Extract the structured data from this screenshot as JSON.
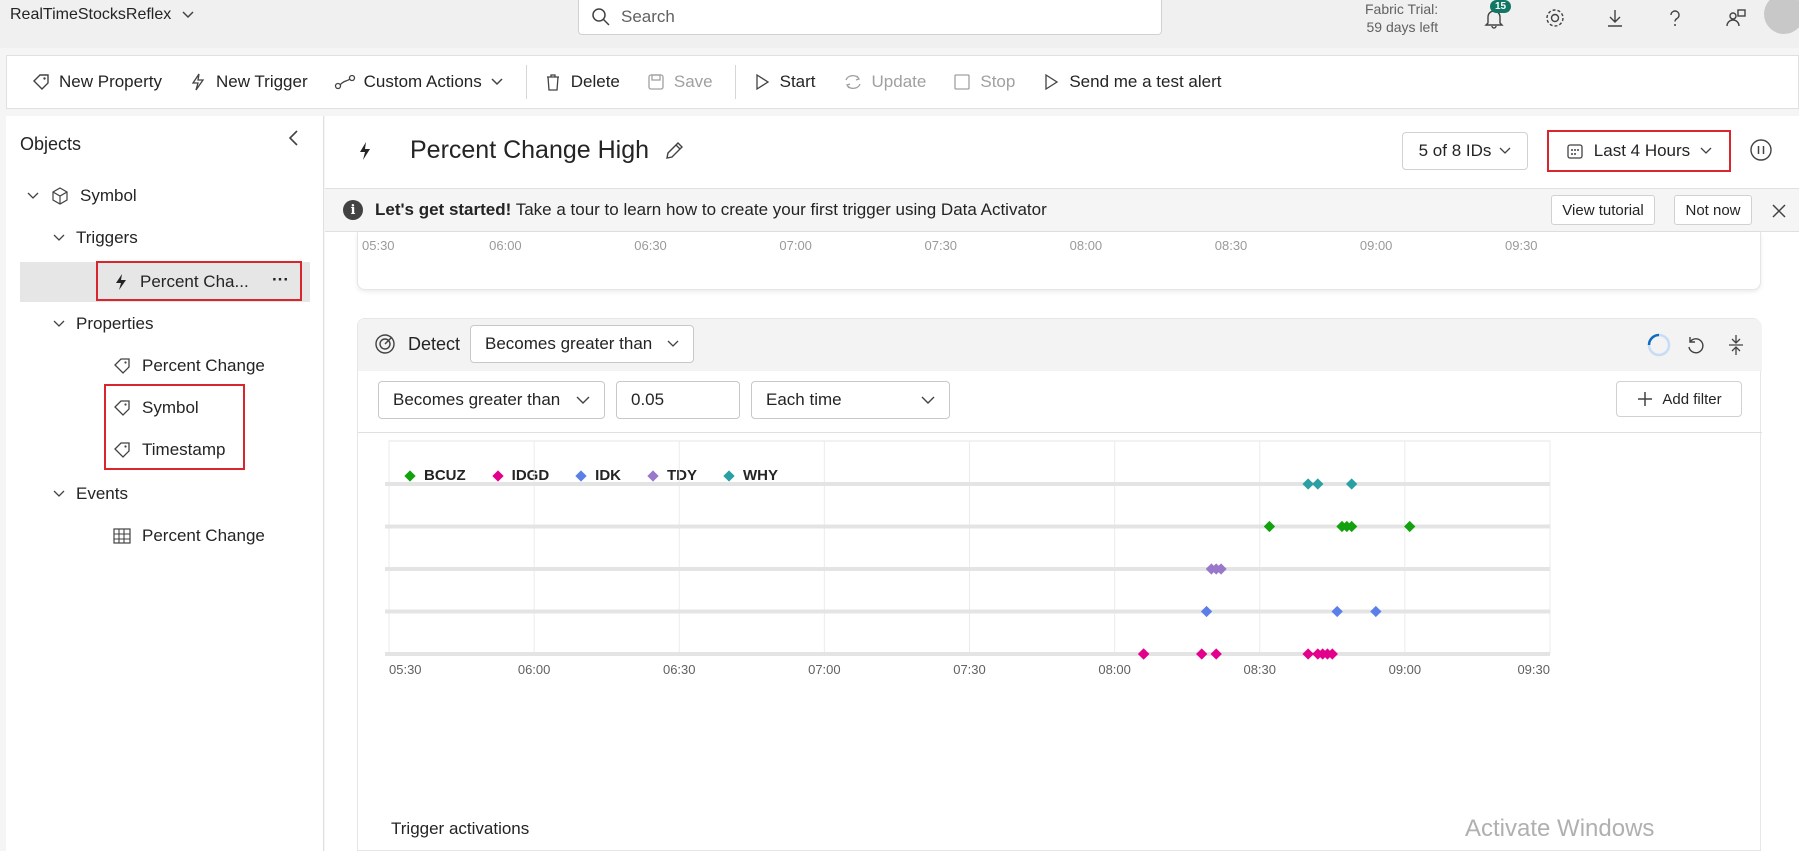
{
  "app": {
    "name": "RealTimeStocksReflex"
  },
  "search": {
    "placeholder": "Search"
  },
  "trial": {
    "line1": "Fabric Trial:",
    "line2": "59 days left"
  },
  "notifications": {
    "count": "15"
  },
  "toolbar": {
    "new_property": "New Property",
    "new_trigger": "New Trigger",
    "custom_actions": "Custom Actions",
    "delete": "Delete",
    "save": "Save",
    "start": "Start",
    "update": "Update",
    "stop": "Stop",
    "send_test": "Send me a test alert"
  },
  "sidebar": {
    "title": "Objects",
    "object": "Symbol",
    "triggers_label": "Triggers",
    "trigger_item": "Percent Cha...",
    "trigger_more": "···",
    "properties_label": "Properties",
    "properties": [
      "Percent Change",
      "Symbol",
      "Timestamp"
    ],
    "events_label": "Events",
    "event_item": "Percent Change"
  },
  "main": {
    "title": "Percent Change High",
    "ids_selector": "5 of 8 IDs",
    "time_range": "Last 4 Hours"
  },
  "banner": {
    "bold": "Let's get started!",
    "text": " Take a tour to learn how to create your first trigger using Data Activator",
    "view_tutorial": "View tutorial",
    "not_now": "Not now"
  },
  "detect": {
    "label": "Detect",
    "mode": "Becomes greater than",
    "condition": "Becomes greater than",
    "value": "0.05",
    "frequency": "Each time",
    "add_filter": "Add filter"
  },
  "activations": {
    "title": "Trigger activations"
  },
  "watermark": "Activate Windows",
  "colors": {
    "BCUZ": "#13a10e",
    "IDGD": "#e3008c",
    "IDK": "#5b7fe8",
    "TDY": "#9a78c9",
    "WHY": "#2aa0a4",
    "highlight": "#d9262c"
  },
  "chart_data": {
    "type": "scatter",
    "x_ticks": [
      "05:30",
      "06:00",
      "06:30",
      "07:00",
      "07:30",
      "08:00",
      "08:30",
      "09:00",
      "09:30"
    ],
    "xlim": [
      "05:30",
      "09:30"
    ],
    "series": [
      {
        "name": "BCUZ",
        "x": [
          "08:32",
          "08:47",
          "08:48",
          "08:49",
          "09:01"
        ]
      },
      {
        "name": "IDGD",
        "x": [
          "08:06",
          "08:06",
          "08:18",
          "08:21",
          "08:40",
          "08:42",
          "08:43",
          "08:44",
          "08:45"
        ]
      },
      {
        "name": "IDK",
        "x": [
          "08:19",
          "08:46",
          "08:54"
        ]
      },
      {
        "name": "TDY",
        "x": [
          "08:20",
          "08:21",
          "08:22"
        ]
      },
      {
        "name": "WHY",
        "x": [
          "08:40",
          "08:42",
          "08:49"
        ]
      }
    ],
    "row_order": [
      "WHY",
      "BCUZ",
      "TDY",
      "IDK",
      "IDGD"
    ],
    "grid": true,
    "legend_position": "top-left"
  }
}
